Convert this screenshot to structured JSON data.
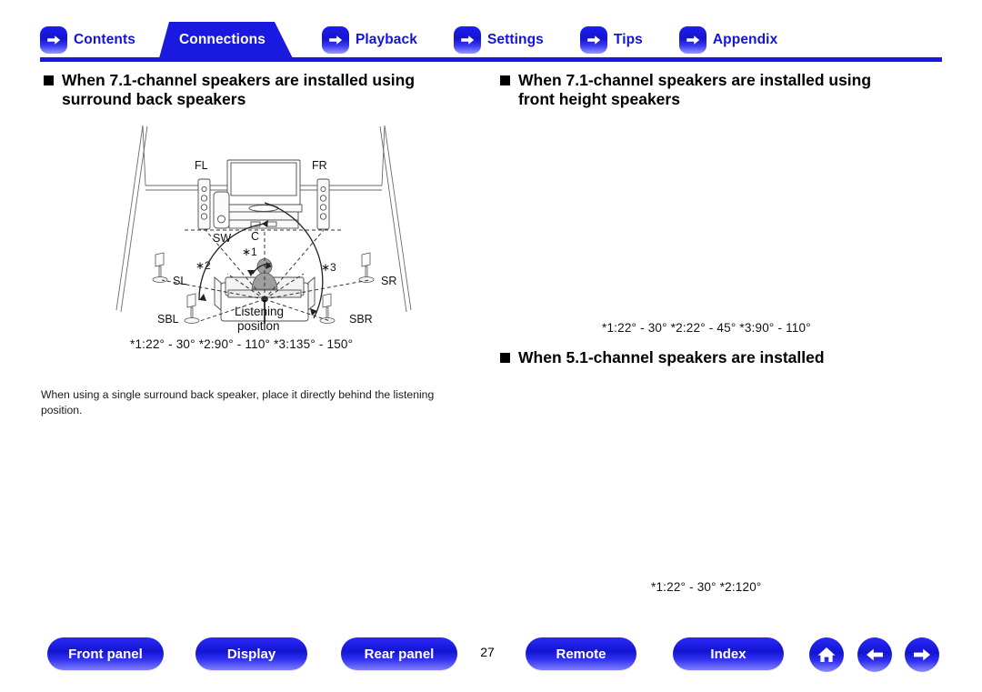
{
  "navigation": {
    "tabs": [
      {
        "label": "Contents",
        "icon": "arrow-right-icon",
        "active": false
      },
      {
        "label": "Connections",
        "icon": "none",
        "active": true
      },
      {
        "label": "Playback",
        "icon": "arrow-right-icon",
        "active": false
      },
      {
        "label": "Settings",
        "icon": "arrow-right-icon",
        "active": false
      },
      {
        "label": "Tips",
        "icon": "arrow-right-icon",
        "active": false
      },
      {
        "label": "Appendix",
        "icon": "arrow-right-icon",
        "active": false
      }
    ],
    "accent_color": "#1919e0"
  },
  "left_column": {
    "heading_line1": "When 7.1-channel speakers are installed using",
    "heading_line2": "surround back speakers",
    "diagram": {
      "speaker_labels": {
        "front_left": "FL",
        "front_right": "FR",
        "subwoofer": "SW",
        "center": "C",
        "surround_left": "SL",
        "surround_right": "SR",
        "surround_back_left": "SBL",
        "surround_back_right": "SBR"
      },
      "angle_markers": [
        "*1",
        "*2",
        "*3"
      ],
      "listening_position_label_line1": "Listening",
      "listening_position_label_line2": "position"
    },
    "angles_note": "*1:22° - 30°  *2:90° - 110°  *3:135° - 150°",
    "body_note": "When using a single surround back speaker, place it directly behind the listening position."
  },
  "right_column": {
    "heading_line1": "When 7.1-channel speakers are installed using",
    "heading_line2": "front height speakers",
    "angles_note": "*1:22° - 30°  *2:22° - 45°  *3:90° - 110°",
    "heading_51": "When 5.1-channel speakers are installed",
    "angles_note_51": "*1:22° - 30°  *2:120°"
  },
  "footer": {
    "buttons": [
      {
        "label": "Front panel"
      },
      {
        "label": "Display"
      },
      {
        "label": "Rear panel"
      },
      {
        "label": "Remote"
      },
      {
        "label": "Index"
      }
    ],
    "page_number": "27",
    "icon_buttons": [
      {
        "name": "home-icon"
      },
      {
        "name": "arrow-left-icon"
      },
      {
        "name": "arrow-right-icon"
      }
    ]
  }
}
